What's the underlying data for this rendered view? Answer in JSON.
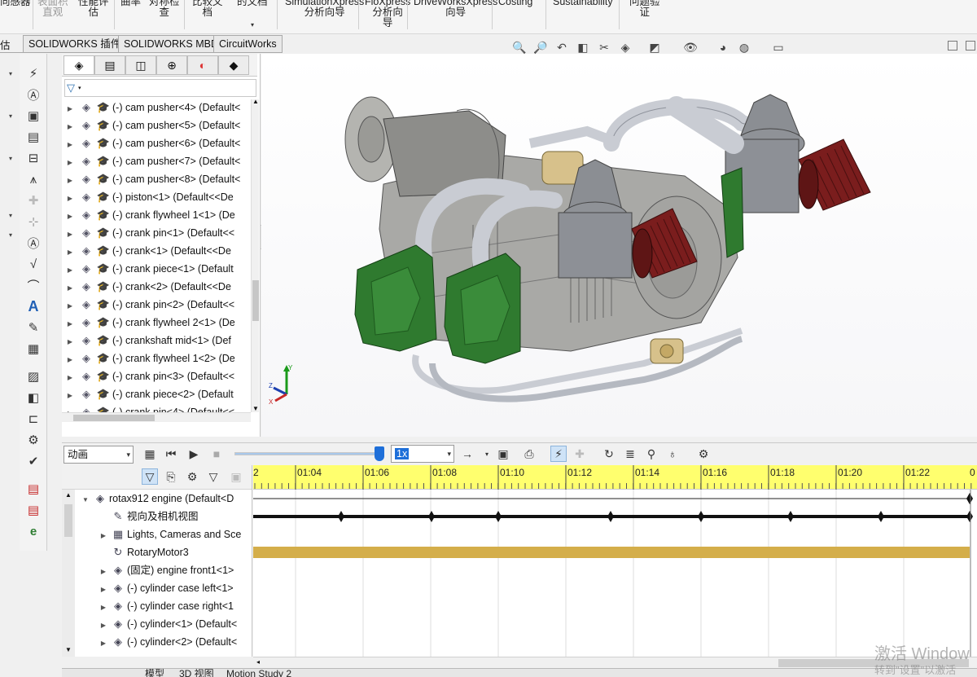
{
  "ribbon": {
    "items": [
      {
        "label": "向感器",
        "dim": false
      },
      {
        "label": "表面积\n直观",
        "dim": true
      },
      {
        "label": "性能评\n估",
        "dim": false
      },
      {
        "label": "曲率",
        "dim": false
      },
      {
        "label": "对称检\n查",
        "dim": false
      },
      {
        "label": "比较文\n档",
        "dim": false
      },
      {
        "label": "的文档",
        "dim": false
      },
      {
        "label": "SimulationXpress\n分析向导",
        "dim": false
      },
      {
        "label": "FloXpress\n分析向\n导",
        "dim": false
      },
      {
        "label": "DriveWorksXpress\n向导",
        "dim": false
      },
      {
        "label": "Costing",
        "dim": false
      },
      {
        "label": "Sustainability",
        "dim": false
      },
      {
        "label": "问题验\n证",
        "dim": false
      }
    ]
  },
  "tabs": {
    "left_stub": "估",
    "items": [
      "SOLIDWORKS 插件",
      "SOLIDWORKS MBD",
      "CircuitWorks"
    ]
  },
  "feature_tree": {
    "rows": [
      "(-) cam pusher<4> (Default<",
      "(-) cam pusher<5> (Default<",
      "(-) cam pusher<6> (Default<",
      "(-) cam pusher<7> (Default<",
      "(-) cam pusher<8> (Default<",
      "(-) piston<1> (Default<<De",
      "(-) crank flywheel 1<1> (De",
      "(-) crank pin<1> (Default<<",
      "(-) crank<1> (Default<<De",
      "(-) crank piece<1> (Default",
      "(-) crank<2> (Default<<De",
      "(-) crank pin<2> (Default<<",
      "(-) crank flywheel 2<1> (De",
      "(-) crankshaft mid<1> (Def",
      "(-) crank flywheel 1<2> (De",
      "(-) crank pin<3> (Default<<",
      "(-) crank piece<2> (Default",
      "(-) crank pin<4> (Default<<"
    ]
  },
  "motion": {
    "study_type": "动画",
    "playback_speed": "1x",
    "tree_rows": [
      {
        "label": "rotax912 engine  (Default<D",
        "expand": "down",
        "indent": 0
      },
      {
        "label": "视向及相机视图",
        "expand": "",
        "indent": 1
      },
      {
        "label": "Lights, Cameras and Sce",
        "expand": "right",
        "indent": 1
      },
      {
        "label": "RotaryMotor3",
        "expand": "",
        "indent": 1
      },
      {
        "label": "(固定) engine front1<1>",
        "expand": "right",
        "indent": 1
      },
      {
        "label": "(-) cylinder case left<1>",
        "expand": "right",
        "indent": 1
      },
      {
        "label": "(-) cylinder case right<1",
        "expand": "right",
        "indent": 1
      },
      {
        "label": "(-) cylinder<1> (Default<",
        "expand": "right",
        "indent": 1
      },
      {
        "label": "(-) cylinder<2> (Default<",
        "expand": "right",
        "indent": 1
      }
    ],
    "timeline": {
      "first_label_partial": "2",
      "ticks": [
        "01:04",
        "01:06",
        "01:08",
        "01:10",
        "01:12",
        "01:14",
        "01:16",
        "01:18",
        "01:20",
        "01:22"
      ],
      "last_label_partial": "0",
      "ruler_color": "#ffff6e",
      "key_color": "#111111",
      "motor_bar_color": "#d4ae4a"
    },
    "bottom_tabs": [
      "模型",
      "3D 视图",
      "Motion Study 2"
    ]
  },
  "colors": {
    "engine_gray": "#a9a9a6",
    "intake_green": "#2f7a2f",
    "filter_red": "#7a1d1d",
    "pipe_light": "#c9ccd3",
    "accent_blue": "#1e6fd9"
  },
  "watermark": {
    "line1": "激活 Window",
    "line2": "转到\"设置\"以激活"
  }
}
